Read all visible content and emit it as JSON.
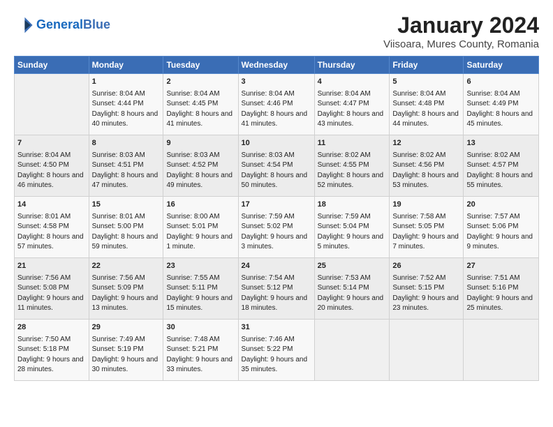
{
  "logo": {
    "line1": "General",
    "line2": "Blue"
  },
  "title": "January 2024",
  "subtitle": "Viisoara, Mures County, Romania",
  "header_days": [
    "Sunday",
    "Monday",
    "Tuesday",
    "Wednesday",
    "Thursday",
    "Friday",
    "Saturday"
  ],
  "weeks": [
    [
      {
        "day": "",
        "sunrise": "",
        "sunset": "",
        "daylight": ""
      },
      {
        "day": "1",
        "sunrise": "Sunrise: 8:04 AM",
        "sunset": "Sunset: 4:44 PM",
        "daylight": "Daylight: 8 hours and 40 minutes."
      },
      {
        "day": "2",
        "sunrise": "Sunrise: 8:04 AM",
        "sunset": "Sunset: 4:45 PM",
        "daylight": "Daylight: 8 hours and 41 minutes."
      },
      {
        "day": "3",
        "sunrise": "Sunrise: 8:04 AM",
        "sunset": "Sunset: 4:46 PM",
        "daylight": "Daylight: 8 hours and 41 minutes."
      },
      {
        "day": "4",
        "sunrise": "Sunrise: 8:04 AM",
        "sunset": "Sunset: 4:47 PM",
        "daylight": "Daylight: 8 hours and 43 minutes."
      },
      {
        "day": "5",
        "sunrise": "Sunrise: 8:04 AM",
        "sunset": "Sunset: 4:48 PM",
        "daylight": "Daylight: 8 hours and 44 minutes."
      },
      {
        "day": "6",
        "sunrise": "Sunrise: 8:04 AM",
        "sunset": "Sunset: 4:49 PM",
        "daylight": "Daylight: 8 hours and 45 minutes."
      }
    ],
    [
      {
        "day": "7",
        "sunrise": "Sunrise: 8:04 AM",
        "sunset": "Sunset: 4:50 PM",
        "daylight": "Daylight: 8 hours and 46 minutes."
      },
      {
        "day": "8",
        "sunrise": "Sunrise: 8:03 AM",
        "sunset": "Sunset: 4:51 PM",
        "daylight": "Daylight: 8 hours and 47 minutes."
      },
      {
        "day": "9",
        "sunrise": "Sunrise: 8:03 AM",
        "sunset": "Sunset: 4:52 PM",
        "daylight": "Daylight: 8 hours and 49 minutes."
      },
      {
        "day": "10",
        "sunrise": "Sunrise: 8:03 AM",
        "sunset": "Sunset: 4:54 PM",
        "daylight": "Daylight: 8 hours and 50 minutes."
      },
      {
        "day": "11",
        "sunrise": "Sunrise: 8:02 AM",
        "sunset": "Sunset: 4:55 PM",
        "daylight": "Daylight: 8 hours and 52 minutes."
      },
      {
        "day": "12",
        "sunrise": "Sunrise: 8:02 AM",
        "sunset": "Sunset: 4:56 PM",
        "daylight": "Daylight: 8 hours and 53 minutes."
      },
      {
        "day": "13",
        "sunrise": "Sunrise: 8:02 AM",
        "sunset": "Sunset: 4:57 PM",
        "daylight": "Daylight: 8 hours and 55 minutes."
      }
    ],
    [
      {
        "day": "14",
        "sunrise": "Sunrise: 8:01 AM",
        "sunset": "Sunset: 4:58 PM",
        "daylight": "Daylight: 8 hours and 57 minutes."
      },
      {
        "day": "15",
        "sunrise": "Sunrise: 8:01 AM",
        "sunset": "Sunset: 5:00 PM",
        "daylight": "Daylight: 8 hours and 59 minutes."
      },
      {
        "day": "16",
        "sunrise": "Sunrise: 8:00 AM",
        "sunset": "Sunset: 5:01 PM",
        "daylight": "Daylight: 9 hours and 1 minute."
      },
      {
        "day": "17",
        "sunrise": "Sunrise: 7:59 AM",
        "sunset": "Sunset: 5:02 PM",
        "daylight": "Daylight: 9 hours and 3 minutes."
      },
      {
        "day": "18",
        "sunrise": "Sunrise: 7:59 AM",
        "sunset": "Sunset: 5:04 PM",
        "daylight": "Daylight: 9 hours and 5 minutes."
      },
      {
        "day": "19",
        "sunrise": "Sunrise: 7:58 AM",
        "sunset": "Sunset: 5:05 PM",
        "daylight": "Daylight: 9 hours and 7 minutes."
      },
      {
        "day": "20",
        "sunrise": "Sunrise: 7:57 AM",
        "sunset": "Sunset: 5:06 PM",
        "daylight": "Daylight: 9 hours and 9 minutes."
      }
    ],
    [
      {
        "day": "21",
        "sunrise": "Sunrise: 7:56 AM",
        "sunset": "Sunset: 5:08 PM",
        "daylight": "Daylight: 9 hours and 11 minutes."
      },
      {
        "day": "22",
        "sunrise": "Sunrise: 7:56 AM",
        "sunset": "Sunset: 5:09 PM",
        "daylight": "Daylight: 9 hours and 13 minutes."
      },
      {
        "day": "23",
        "sunrise": "Sunrise: 7:55 AM",
        "sunset": "Sunset: 5:11 PM",
        "daylight": "Daylight: 9 hours and 15 minutes."
      },
      {
        "day": "24",
        "sunrise": "Sunrise: 7:54 AM",
        "sunset": "Sunset: 5:12 PM",
        "daylight": "Daylight: 9 hours and 18 minutes."
      },
      {
        "day": "25",
        "sunrise": "Sunrise: 7:53 AM",
        "sunset": "Sunset: 5:14 PM",
        "daylight": "Daylight: 9 hours and 20 minutes."
      },
      {
        "day": "26",
        "sunrise": "Sunrise: 7:52 AM",
        "sunset": "Sunset: 5:15 PM",
        "daylight": "Daylight: 9 hours and 23 minutes."
      },
      {
        "day": "27",
        "sunrise": "Sunrise: 7:51 AM",
        "sunset": "Sunset: 5:16 PM",
        "daylight": "Daylight: 9 hours and 25 minutes."
      }
    ],
    [
      {
        "day": "28",
        "sunrise": "Sunrise: 7:50 AM",
        "sunset": "Sunset: 5:18 PM",
        "daylight": "Daylight: 9 hours and 28 minutes."
      },
      {
        "day": "29",
        "sunrise": "Sunrise: 7:49 AM",
        "sunset": "Sunset: 5:19 PM",
        "daylight": "Daylight: 9 hours and 30 minutes."
      },
      {
        "day": "30",
        "sunrise": "Sunrise: 7:48 AM",
        "sunset": "Sunset: 5:21 PM",
        "daylight": "Daylight: 9 hours and 33 minutes."
      },
      {
        "day": "31",
        "sunrise": "Sunrise: 7:46 AM",
        "sunset": "Sunset: 5:22 PM",
        "daylight": "Daylight: 9 hours and 35 minutes."
      },
      {
        "day": "",
        "sunrise": "",
        "sunset": "",
        "daylight": ""
      },
      {
        "day": "",
        "sunrise": "",
        "sunset": "",
        "daylight": ""
      },
      {
        "day": "",
        "sunrise": "",
        "sunset": "",
        "daylight": ""
      }
    ]
  ]
}
